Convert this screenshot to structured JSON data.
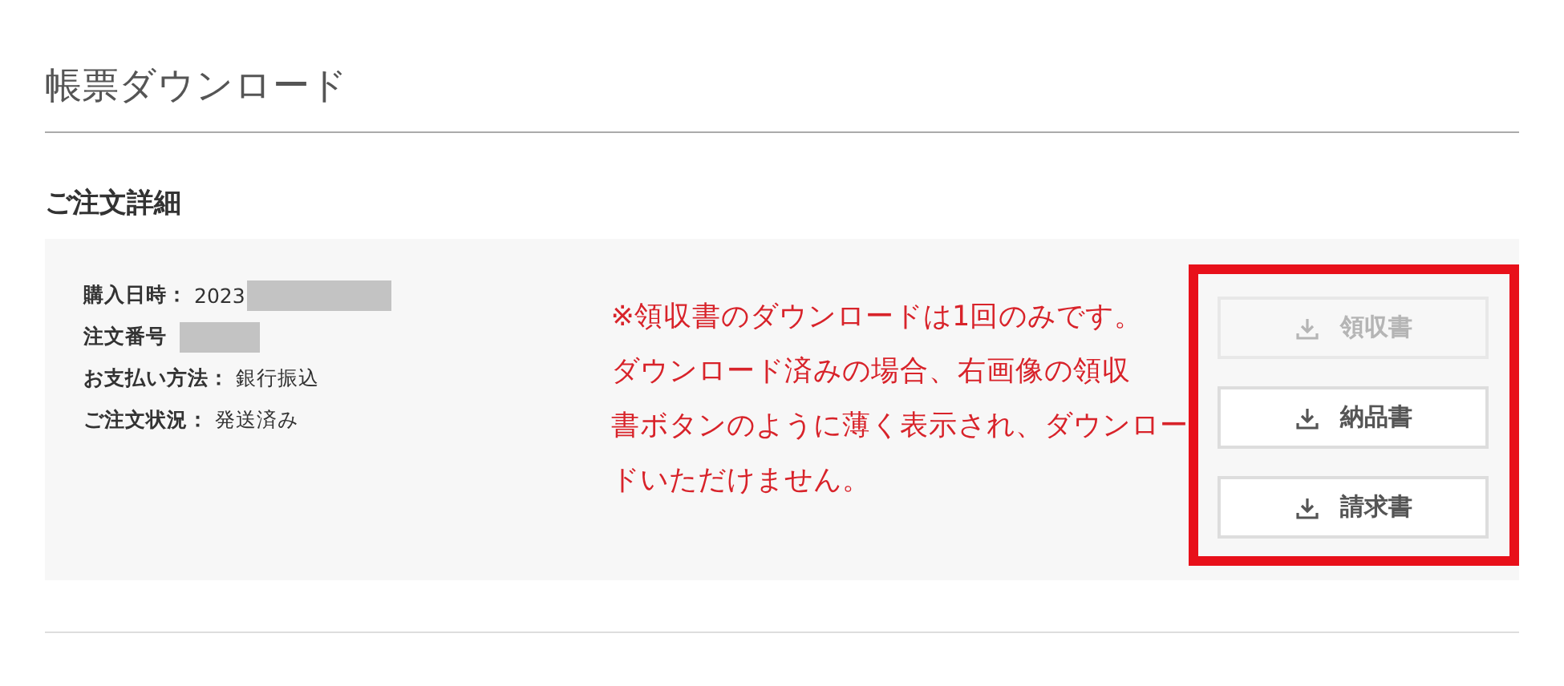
{
  "page_title": "帳票ダウンロード",
  "section_title": "ご注文詳細",
  "details": [
    {
      "label": "購入日時：",
      "value": "2023",
      "redacted": true
    },
    {
      "label": "注文番号",
      "redacted": true
    },
    {
      "label": "お支払い方法：",
      "value": "銀行振込",
      "redacted": false
    },
    {
      "label": "ご注文状況：",
      "value": "発送済み",
      "redacted": false
    }
  ],
  "note": {
    "lines": [
      "※領収書のダウンロードは1回のみです。",
      "ダウンロード済みの場合、右画像の領収",
      "書ボタンのように薄く表示され、ダウンロー",
      "ドいただけません。"
    ]
  },
  "buttons": [
    {
      "label": "領収書",
      "disabled": true
    },
    {
      "label": "納品書",
      "disabled": false
    },
    {
      "label": "請求書",
      "disabled": false
    }
  ]
}
